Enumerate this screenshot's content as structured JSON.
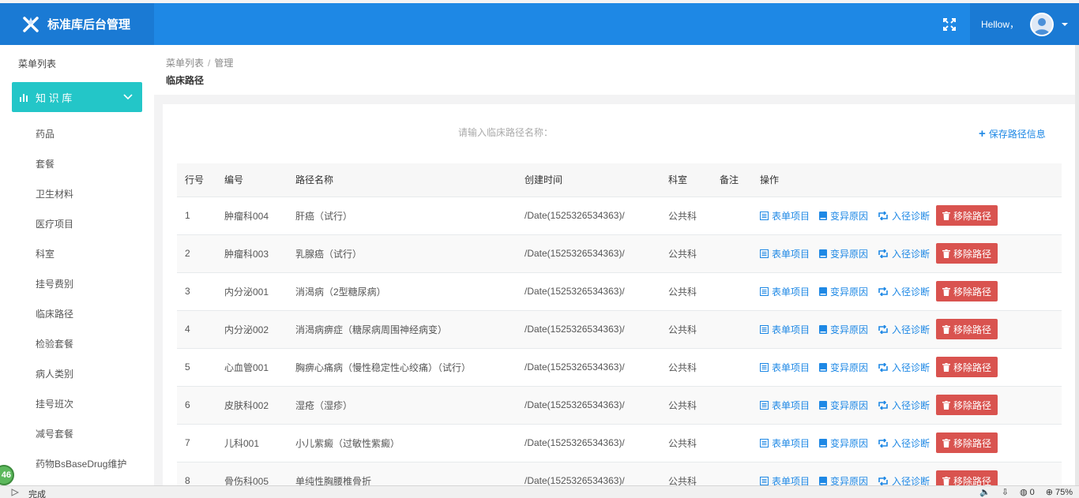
{
  "app": {
    "title": "标准库后台管理"
  },
  "header": {
    "greeting": "Hellow，"
  },
  "sidebar": {
    "menu_title": "菜单列表",
    "group_label": "知 识 库",
    "items": [
      "药品",
      "套餐",
      "卫生材料",
      "医疗项目",
      "科室",
      "挂号费别",
      "临床路径",
      "检验套餐",
      "病人类别",
      "挂号班次",
      "减号套餐",
      "药物BsBaseDrug维护"
    ]
  },
  "breadcrumb": {
    "root": "菜单列表",
    "separator": "/",
    "current": "管理"
  },
  "page": {
    "title": "临床路径"
  },
  "search": {
    "label": "请输入临床路径名称："
  },
  "toolbar": {
    "save_label": "保存路径信息"
  },
  "table": {
    "columns": [
      "行号",
      "编号",
      "路径名称",
      "创建时间",
      "科室",
      "备注",
      "操作"
    ],
    "actions": {
      "form": "表单项目",
      "variation": "变异原因",
      "enter": "入径诊断",
      "remove": "移除路径"
    },
    "rows": [
      {
        "num": "1",
        "code": "肿瘤科004",
        "name": "肝癌（试行）",
        "created": "/Date(1525326534363)/",
        "dept": "公共科",
        "note": ""
      },
      {
        "num": "2",
        "code": "肿瘤科003",
        "name": "乳腺癌（试行）",
        "created": "/Date(1525326534363)/",
        "dept": "公共科",
        "note": ""
      },
      {
        "num": "3",
        "code": "内分泌001",
        "name": "消渴病（2型糖尿病）",
        "created": "/Date(1525326534363)/",
        "dept": "公共科",
        "note": ""
      },
      {
        "num": "4",
        "code": "内分泌002",
        "name": "消渴病痹症（糖尿病周围神经病变）",
        "created": "/Date(1525326534363)/",
        "dept": "公共科",
        "note": ""
      },
      {
        "num": "5",
        "code": "心血管001",
        "name": "胸痹心痛病（慢性稳定性心绞痛）（试行）",
        "created": "/Date(1525326534363)/",
        "dept": "公共科",
        "note": ""
      },
      {
        "num": "6",
        "code": "皮肤科002",
        "name": "湿疮（湿疹）",
        "created": "/Date(1525326534363)/",
        "dept": "公共科",
        "note": ""
      },
      {
        "num": "7",
        "code": "儿科001",
        "name": "小儿紫癜（过敏性紫癜）",
        "created": "/Date(1525326534363)/",
        "dept": "公共科",
        "note": ""
      },
      {
        "num": "8",
        "code": "骨伤科005",
        "name": "单纯性胸腰椎骨折",
        "created": "/Date(1525326534363)/",
        "dept": "公共科",
        "note": ""
      }
    ]
  },
  "statusbar": {
    "status": "完成",
    "badge": "46",
    "counter": "0",
    "zoom": "75%"
  },
  "colors": {
    "header": "#1e88e5",
    "accent": "#23c6c8",
    "danger": "#d9534f",
    "link": "#1e88e5"
  }
}
